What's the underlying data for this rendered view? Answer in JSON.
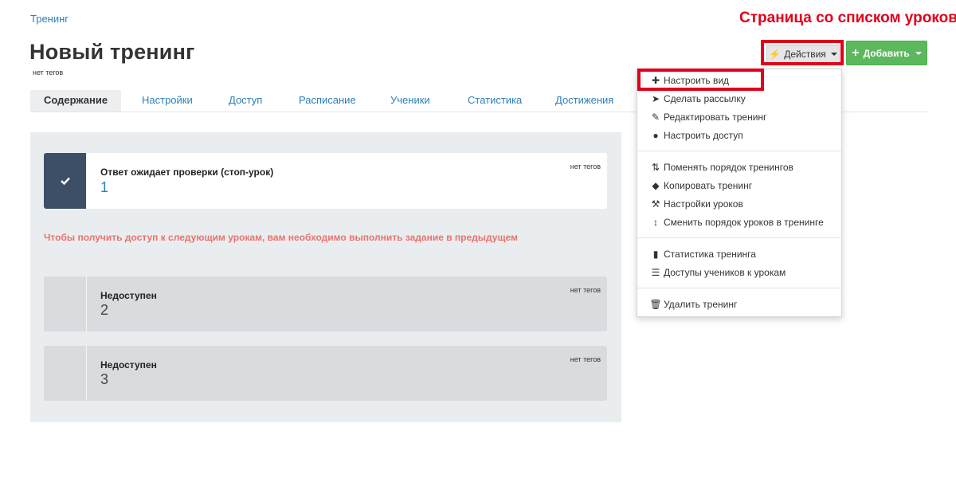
{
  "breadcrumb": "Тренинг",
  "annotation": "Страница со списком уроков",
  "page": {
    "title": "Новый тренинг",
    "tags": "нет тегов"
  },
  "toolbar": {
    "actions_label": "Действия",
    "add_label": "Добавить"
  },
  "tabs": [
    {
      "label": "Содержание"
    },
    {
      "label": "Настройки"
    },
    {
      "label": "Доступ"
    },
    {
      "label": "Расписание"
    },
    {
      "label": "Ученики"
    },
    {
      "label": "Статистика"
    },
    {
      "label": "Достижения"
    }
  ],
  "lessons": [
    {
      "title": "Ответ ожидает проверки (стоп-урок)",
      "number": "1",
      "tags": "нет тегов",
      "status_icon": "check-icon"
    },
    {
      "title": "Недоступен",
      "number": "2",
      "tags": "нет тегов"
    },
    {
      "title": "Недоступен",
      "number": "3",
      "tags": "нет тегов"
    }
  ],
  "warning": "Чтобы получить доступ к следующим урокам, вам необходимо выполнить задание в предыдущем",
  "menu": {
    "items": [
      {
        "label": "Настроить вид",
        "icon": "puzzle-icon"
      },
      {
        "label": "Сделать рассылку",
        "icon": "paper-plane-icon"
      },
      {
        "label": "Редактировать тренинг",
        "icon": "edit-icon"
      },
      {
        "label": "Настроить доступ",
        "icon": "user-icon"
      },
      {
        "label": "Поменять порядок тренингов",
        "icon": "sort-icon"
      },
      {
        "label": "Копировать тренинг",
        "icon": "tags-icon"
      },
      {
        "label": "Настройки уроков",
        "icon": "wrench-icon"
      },
      {
        "label": "Сменить порядок уроков в тренинге",
        "icon": "sort-arrows-icon"
      },
      {
        "label": "Статистика тренинга",
        "icon": "bar-chart-icon"
      },
      {
        "label": "Доступы учеников к урокам",
        "icon": "list-icon"
      },
      {
        "label": "Удалить тренинг",
        "icon": "trash-icon"
      }
    ]
  },
  "colors": {
    "link": "#2c7fb8",
    "primary_green": "#5cb85c",
    "annotation_red": "#e0001b",
    "warning_red": "#e8736c",
    "lesson_dark": "#3d4f66"
  }
}
